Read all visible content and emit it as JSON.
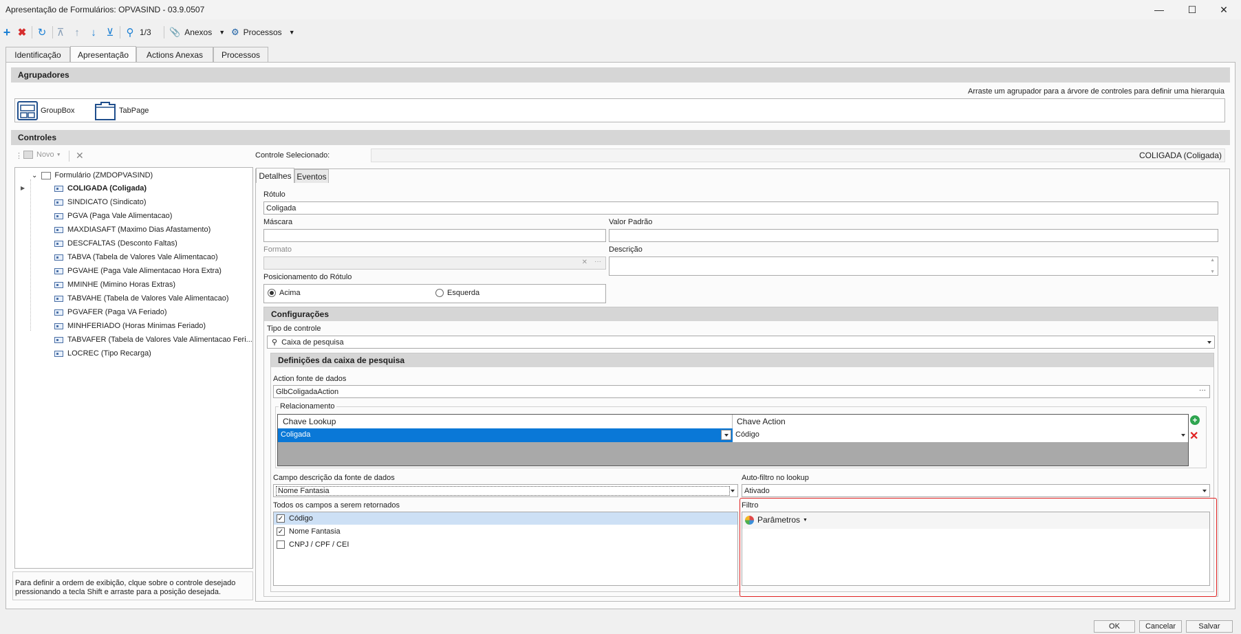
{
  "window": {
    "title": "Apresentação de Formulários: OPVASIND - 03.9.0507"
  },
  "toolbar": {
    "record_position": "1/3",
    "anexos_label": "Anexos",
    "processos_label": "Processos"
  },
  "tabs": [
    {
      "label": "Identificação"
    },
    {
      "label": "Apresentação"
    },
    {
      "label": "Actions Anexas"
    },
    {
      "label": "Processos"
    }
  ],
  "agrupadores": {
    "title": "Agrupadores",
    "hint": "Arraste um agrupador para a árvore de controles para definir uma hierarquia",
    "items": [
      {
        "label": "GroupBox"
      },
      {
        "label": "TabPage"
      }
    ]
  },
  "controles": {
    "title": "Controles",
    "novo_label": "Novo",
    "selected_label": "Controle Selecionado:",
    "selected_value": "COLIGADA (Coligada)",
    "tree_root": "Formulário (ZMDOPVASIND)",
    "tree_items": [
      {
        "label": "COLIGADA (Coligada)"
      },
      {
        "label": "SINDICATO (Sindicato)"
      },
      {
        "label": "PGVA (Paga Vale Alimentacao)"
      },
      {
        "label": "MAXDIASAFT (Maximo Dias Afastamento)"
      },
      {
        "label": "DESCFALTAS (Desconto Faltas)"
      },
      {
        "label": "TABVA (Tabela de Valores Vale Alimentacao)"
      },
      {
        "label": "PGVAHE (Paga Vale Alimentacao Hora Extra)"
      },
      {
        "label": "MMINHE (Mimino Horas Extras)"
      },
      {
        "label": "TABVAHE (Tabela de Valores Vale Alimentacao)"
      },
      {
        "label": "PGVAFER (Paga VA Feriado)"
      },
      {
        "label": "MINHFERIADO (Horas Minimas Feriado)"
      },
      {
        "label": "TABVAFER (Tabela de Valores Vale Alimentacao Feri..."
      },
      {
        "label": "LOCREC (Tipo Recarga)"
      }
    ],
    "help_text": "Para definir a ordem de exibição, clque sobre o controle desejado pressionando a tecla Shift e arraste para a posição desejada."
  },
  "details": {
    "tabs": [
      {
        "label": "Detalhes"
      },
      {
        "label": "Eventos"
      }
    ],
    "rotulo_label": "Rótulo",
    "rotulo_value": "Coligada",
    "mascara_label": "Máscara",
    "mascara_value": "",
    "valor_padrao_label": "Valor Padrão",
    "valor_padrao_value": "",
    "formato_label": "Formato",
    "descricao_label": "Descrição",
    "posicionamento_label": "Posicionamento do Rótulo",
    "radio_acima": "Acima",
    "radio_esquerda": "Esquerda",
    "radio_selected": "Acima"
  },
  "configuracoes": {
    "title": "Configurações",
    "tipo_label": "Tipo de controle",
    "tipo_value": "Caixa de pesquisa",
    "definicoes_title": "Definições da caixa de pesquisa",
    "action_label": "Action fonte de dados",
    "action_value": "GlbColigadaAction",
    "relacionamento_label": "Relacionamento",
    "grid_headers": [
      "Chave Lookup",
      "Chave Action"
    ],
    "grid_row": {
      "lookup": "Coligada",
      "action": "Código"
    },
    "campo_desc_label": "Campo descrição da fonte de dados",
    "campo_desc_value": "Nome Fantasia",
    "auto_filtro_label": "Auto-filtro no lookup",
    "auto_filtro_value": "Ativado",
    "todos_campos_label": "Todos os campos a serem retornados",
    "campos": [
      {
        "label": "Código",
        "checked": true
      },
      {
        "label": "Nome Fantasia",
        "checked": true
      },
      {
        "label": "CNPJ / CPF / CEI",
        "checked": false
      }
    ],
    "filtro_label": "Filtro",
    "parametros_label": "Parâmetros"
  },
  "footer": {
    "ok_label": "OK",
    "cancel_label": "Cancelar",
    "save_label": "Salvar"
  },
  "colors": {
    "selection": "#0a78d7",
    "highlight_border": "#e02020",
    "add_green": "#2ea44f",
    "delete_red": "#e02020"
  }
}
